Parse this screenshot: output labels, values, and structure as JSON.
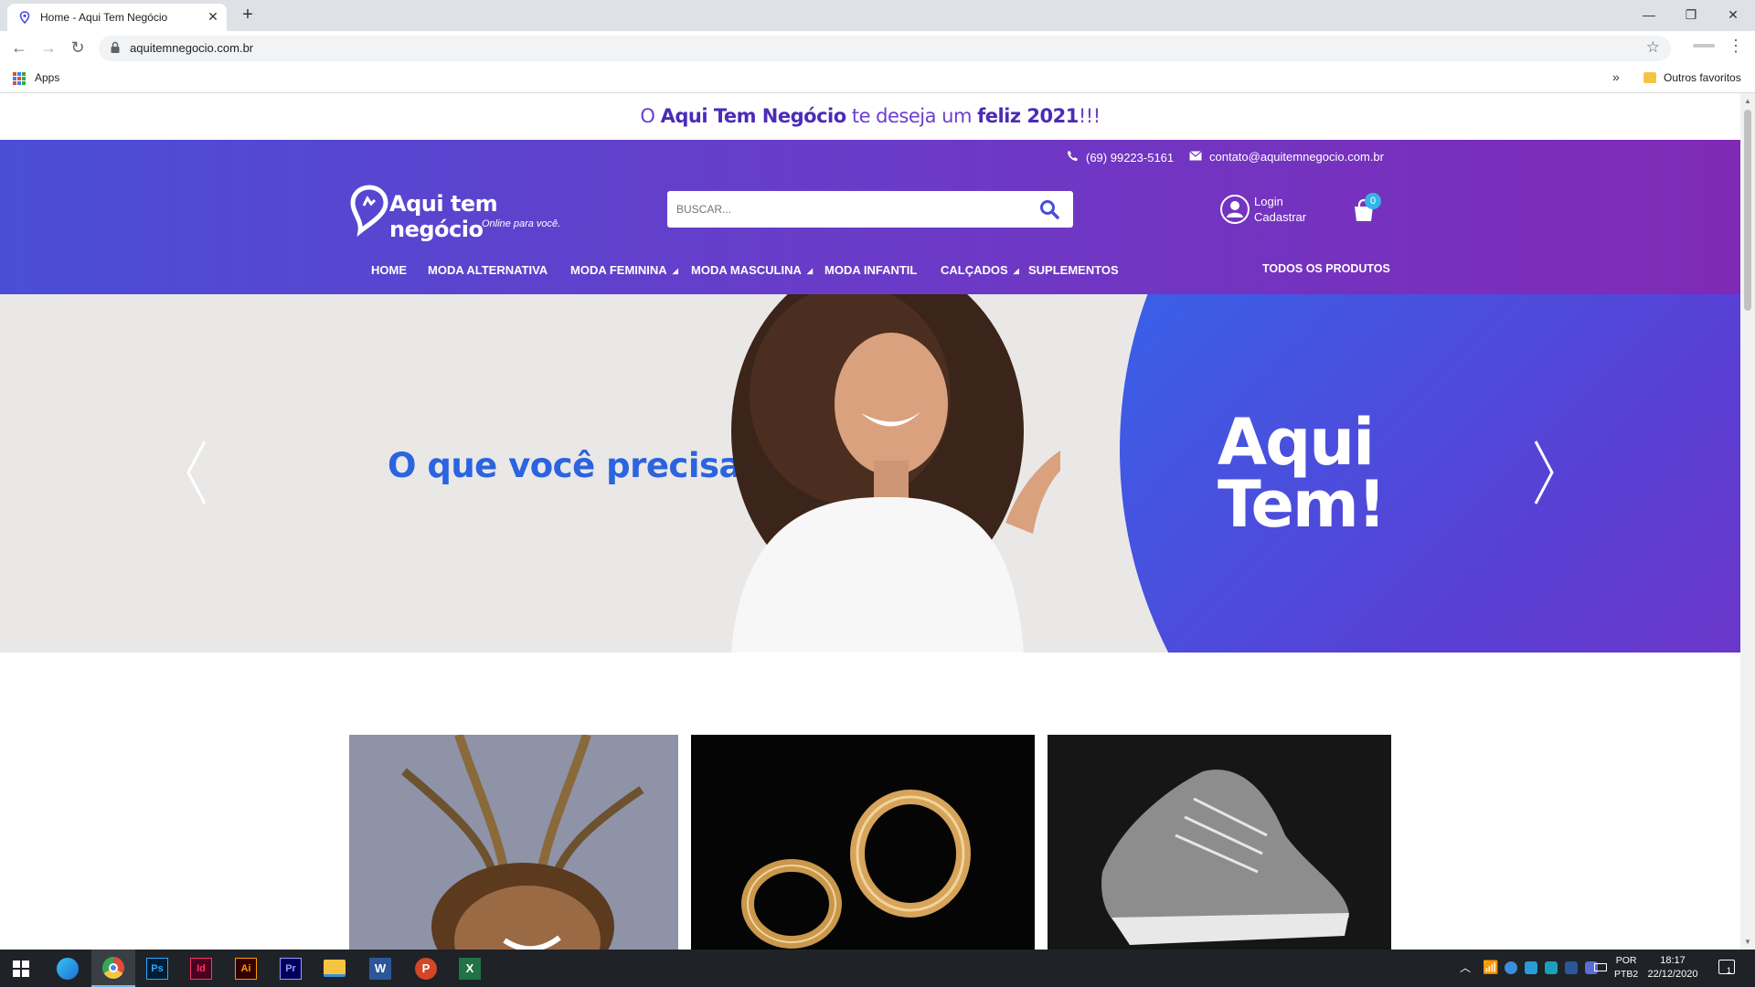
{
  "browser": {
    "tab_title": "Home - Aqui Tem Negócio",
    "tab_close": "✕",
    "new_tab": "+",
    "url": "aquitemnegocio.com.br",
    "window": {
      "minimize": "—",
      "maximize": "❐",
      "close": "✕"
    },
    "nav": {
      "back": "←",
      "forward": "→",
      "reload": "↻"
    },
    "bookmarks": {
      "apps_label": "Apps",
      "more": "»",
      "other_favorites": "Outros favoritos"
    },
    "icons": [
      "location-pin-icon",
      "lock-icon",
      "star-icon",
      "kebab-menu-icon",
      "apps-grid-icon",
      "folder-icon"
    ]
  },
  "announcement": {
    "part1": "O ",
    "brand": "Aqui Tem Negócio",
    "part2": " te deseja um ",
    "highlight": "feliz 2021",
    "ending": "!!!"
  },
  "header": {
    "phone": "(69) 99223-5161",
    "email": "contato@aquitemnegocio.com.br",
    "logo_title": "Aqui tem negócio",
    "logo_subtitle": "Online para você.",
    "search_placeholder": "BUSCAR...",
    "login_label": "Login",
    "register_label": "Cadastrar",
    "cart_count": "0"
  },
  "menu": {
    "items": [
      {
        "label": "HOME"
      },
      {
        "label": "MODA ALTERNATIVA"
      },
      {
        "label": "MODA FEMININA",
        "has_submenu": true
      },
      {
        "label": "MODA MASCULINA",
        "has_submenu": true
      },
      {
        "label": "MODA INFANTIL"
      },
      {
        "label": "CALÇADOS",
        "has_submenu": true
      },
      {
        "label": "SUPLEMENTOS"
      }
    ],
    "all_products": "TODOS OS PRODUTOS"
  },
  "slider": {
    "headline": "O que você precisa?",
    "cta_line1": "Aqui",
    "cta_line2": "Tem!"
  },
  "categories": [
    {
      "image": "woman-braids-photo"
    },
    {
      "image": "gold-earrings-photo"
    },
    {
      "image": "sneaker-photo"
    }
  ],
  "taskbar": {
    "time": "18:17",
    "date": "22/12/2020",
    "lang_top": "POR",
    "lang_bottom": "PTB2",
    "apps": [
      "Edge",
      "Chrome",
      "Ps",
      "Id",
      "Ai",
      "Pr",
      "Explorer",
      "Word",
      "PowerPoint",
      "Excel"
    ],
    "notification_count": "1"
  },
  "colors": {
    "header_start": "#4a4ed6",
    "header_end": "#7f2ab6",
    "accent_blue": "#2b63e0",
    "cart_badge": "#35b3e8"
  }
}
